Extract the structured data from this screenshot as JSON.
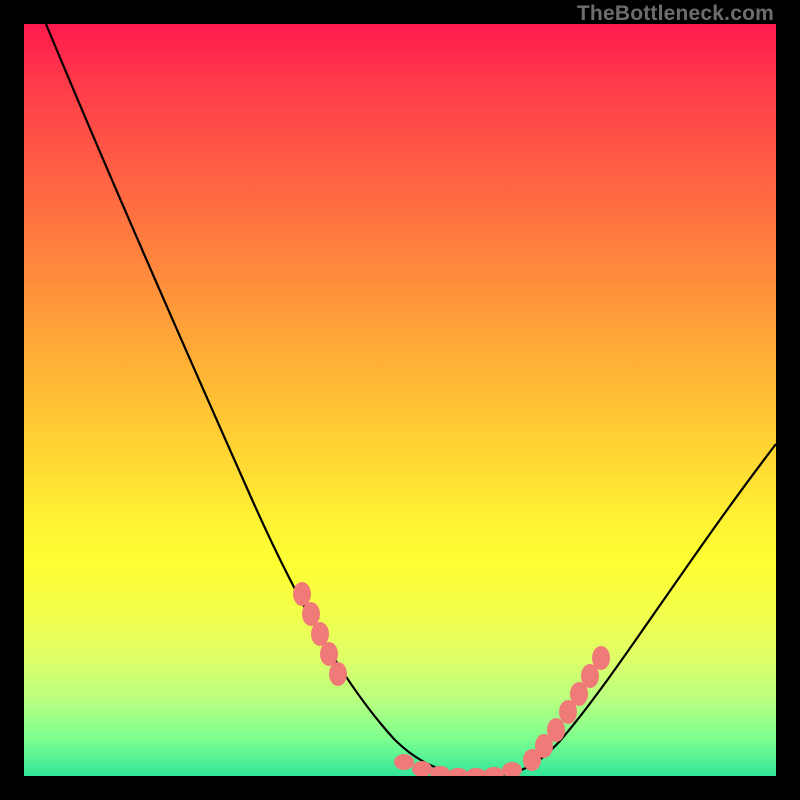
{
  "watermark": "TheBottleneck.com",
  "chart_data": {
    "type": "line",
    "title": "",
    "xlabel": "",
    "ylabel": "",
    "xlim": [
      0,
      100
    ],
    "ylim": [
      0,
      100
    ],
    "grid": false,
    "legend": false,
    "series": [
      {
        "name": "bottleneck-curve",
        "x": [
          3,
          8,
          14,
          20,
          26,
          32,
          36,
          40,
          44,
          48,
          52,
          55,
          58,
          61,
          64,
          68,
          72,
          76,
          80,
          84,
          88,
          92,
          96,
          100
        ],
        "y": [
          100,
          90,
          78,
          66,
          54,
          42,
          34,
          26,
          18,
          11,
          6,
          3,
          1,
          0,
          0,
          1,
          4,
          9,
          16,
          24,
          32,
          40,
          48,
          56
        ]
      }
    ],
    "markers": {
      "name": "salmon-dots",
      "note": "approximate positions of the salmon scatter markers along the curve",
      "x": [
        36,
        37.5,
        39,
        40.5,
        42,
        52,
        54,
        56,
        58,
        60,
        62,
        64,
        66,
        68,
        69.5,
        71,
        72.5,
        74,
        76
      ],
      "y": [
        34,
        31,
        28,
        25,
        22,
        6,
        4.5,
        3,
        2,
        1.2,
        0.6,
        0.3,
        0.3,
        1,
        2.3,
        4,
        6,
        8.5,
        12
      ]
    },
    "background_gradient": {
      "top": "#ff1a4d",
      "mid_upper": "#ff9a3a",
      "mid_lower": "#feff33",
      "bottom": "#33e59a"
    },
    "colors": {
      "curve": "#000000",
      "markers": "#ef7a78",
      "frame": "#000000"
    }
  }
}
